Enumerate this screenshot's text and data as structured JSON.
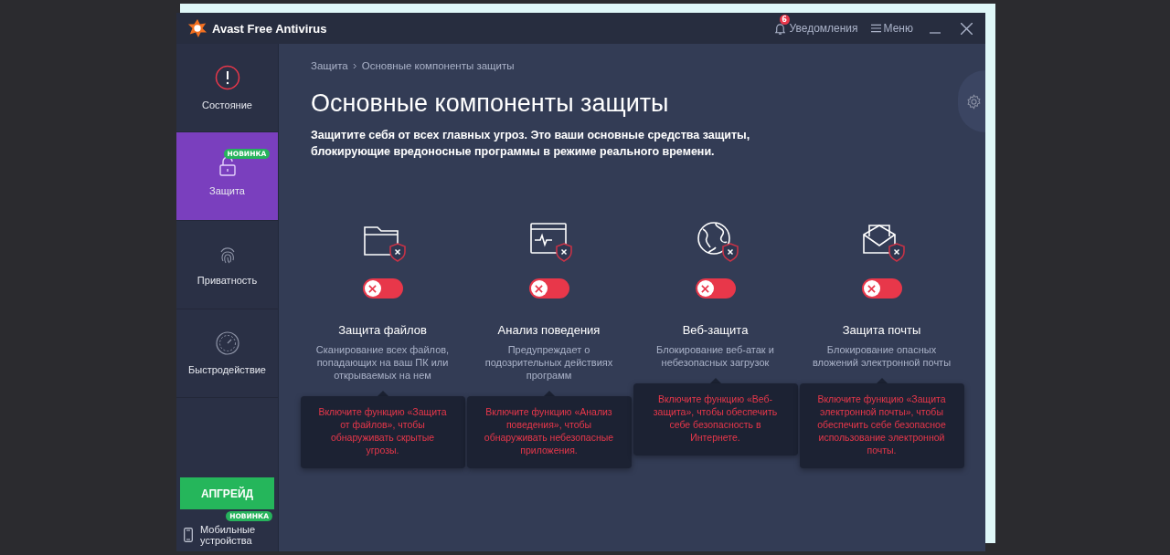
{
  "window": {
    "title": "Avast Free Antivirus",
    "notifications": {
      "count": "6",
      "label": "Уведомления"
    },
    "menu": "Меню"
  },
  "sidebar": {
    "items": [
      {
        "kind": "status",
        "label": "Состояние",
        "selected": false
      },
      {
        "kind": "protection",
        "label": "Защита",
        "selected": true,
        "badge": "НОВИНКА"
      },
      {
        "kind": "privacy",
        "label": "Приватность",
        "selected": false
      },
      {
        "kind": "performance",
        "label": "Быстродействие",
        "selected": false
      }
    ],
    "upgrade": "АПГРЕЙД",
    "mobile": {
      "label": "Мобильные устройства",
      "badge": "НОВИНКА"
    }
  },
  "breadcrumb": [
    "Защита",
    "Основные компоненты защиты"
  ],
  "heading": "Основные компоненты защиты",
  "description": "Защитите себя от всех главных угроз. Это ваши основные средства защиты, блокирующие вредоносные программы в режиме реального времени.",
  "components": [
    {
      "kind": "files",
      "name": "Защита файлов",
      "on": false,
      "text": "Сканирование всех файлов, попадающих на ваш ПК или открываемых на нем",
      "tip": "Включите функцию «Защита от файлов», чтобы обнаруживать скрытые угрозы."
    },
    {
      "kind": "behavior",
      "name": "Анализ поведения",
      "on": false,
      "text": "Предупреждает о подозрительных действиях программ",
      "tip": "Включите функцию «Анализ поведения», чтобы обнаруживать небезопасные приложения."
    },
    {
      "kind": "web",
      "name": "Веб-защита",
      "on": false,
      "text": "Блокирование веб-атак и небезопасных загрузок",
      "tip": "Включите функцию «Веб-защита», чтобы обеспечить себе безопасность в Интернете."
    },
    {
      "kind": "mail",
      "name": "Защита почты",
      "on": false,
      "text": "Блокирование опасных вложений электронной почты",
      "tip": "Включите функцию «Защита электронной почты», чтобы обеспечить себе безопасное использование электронной почты."
    }
  ]
}
